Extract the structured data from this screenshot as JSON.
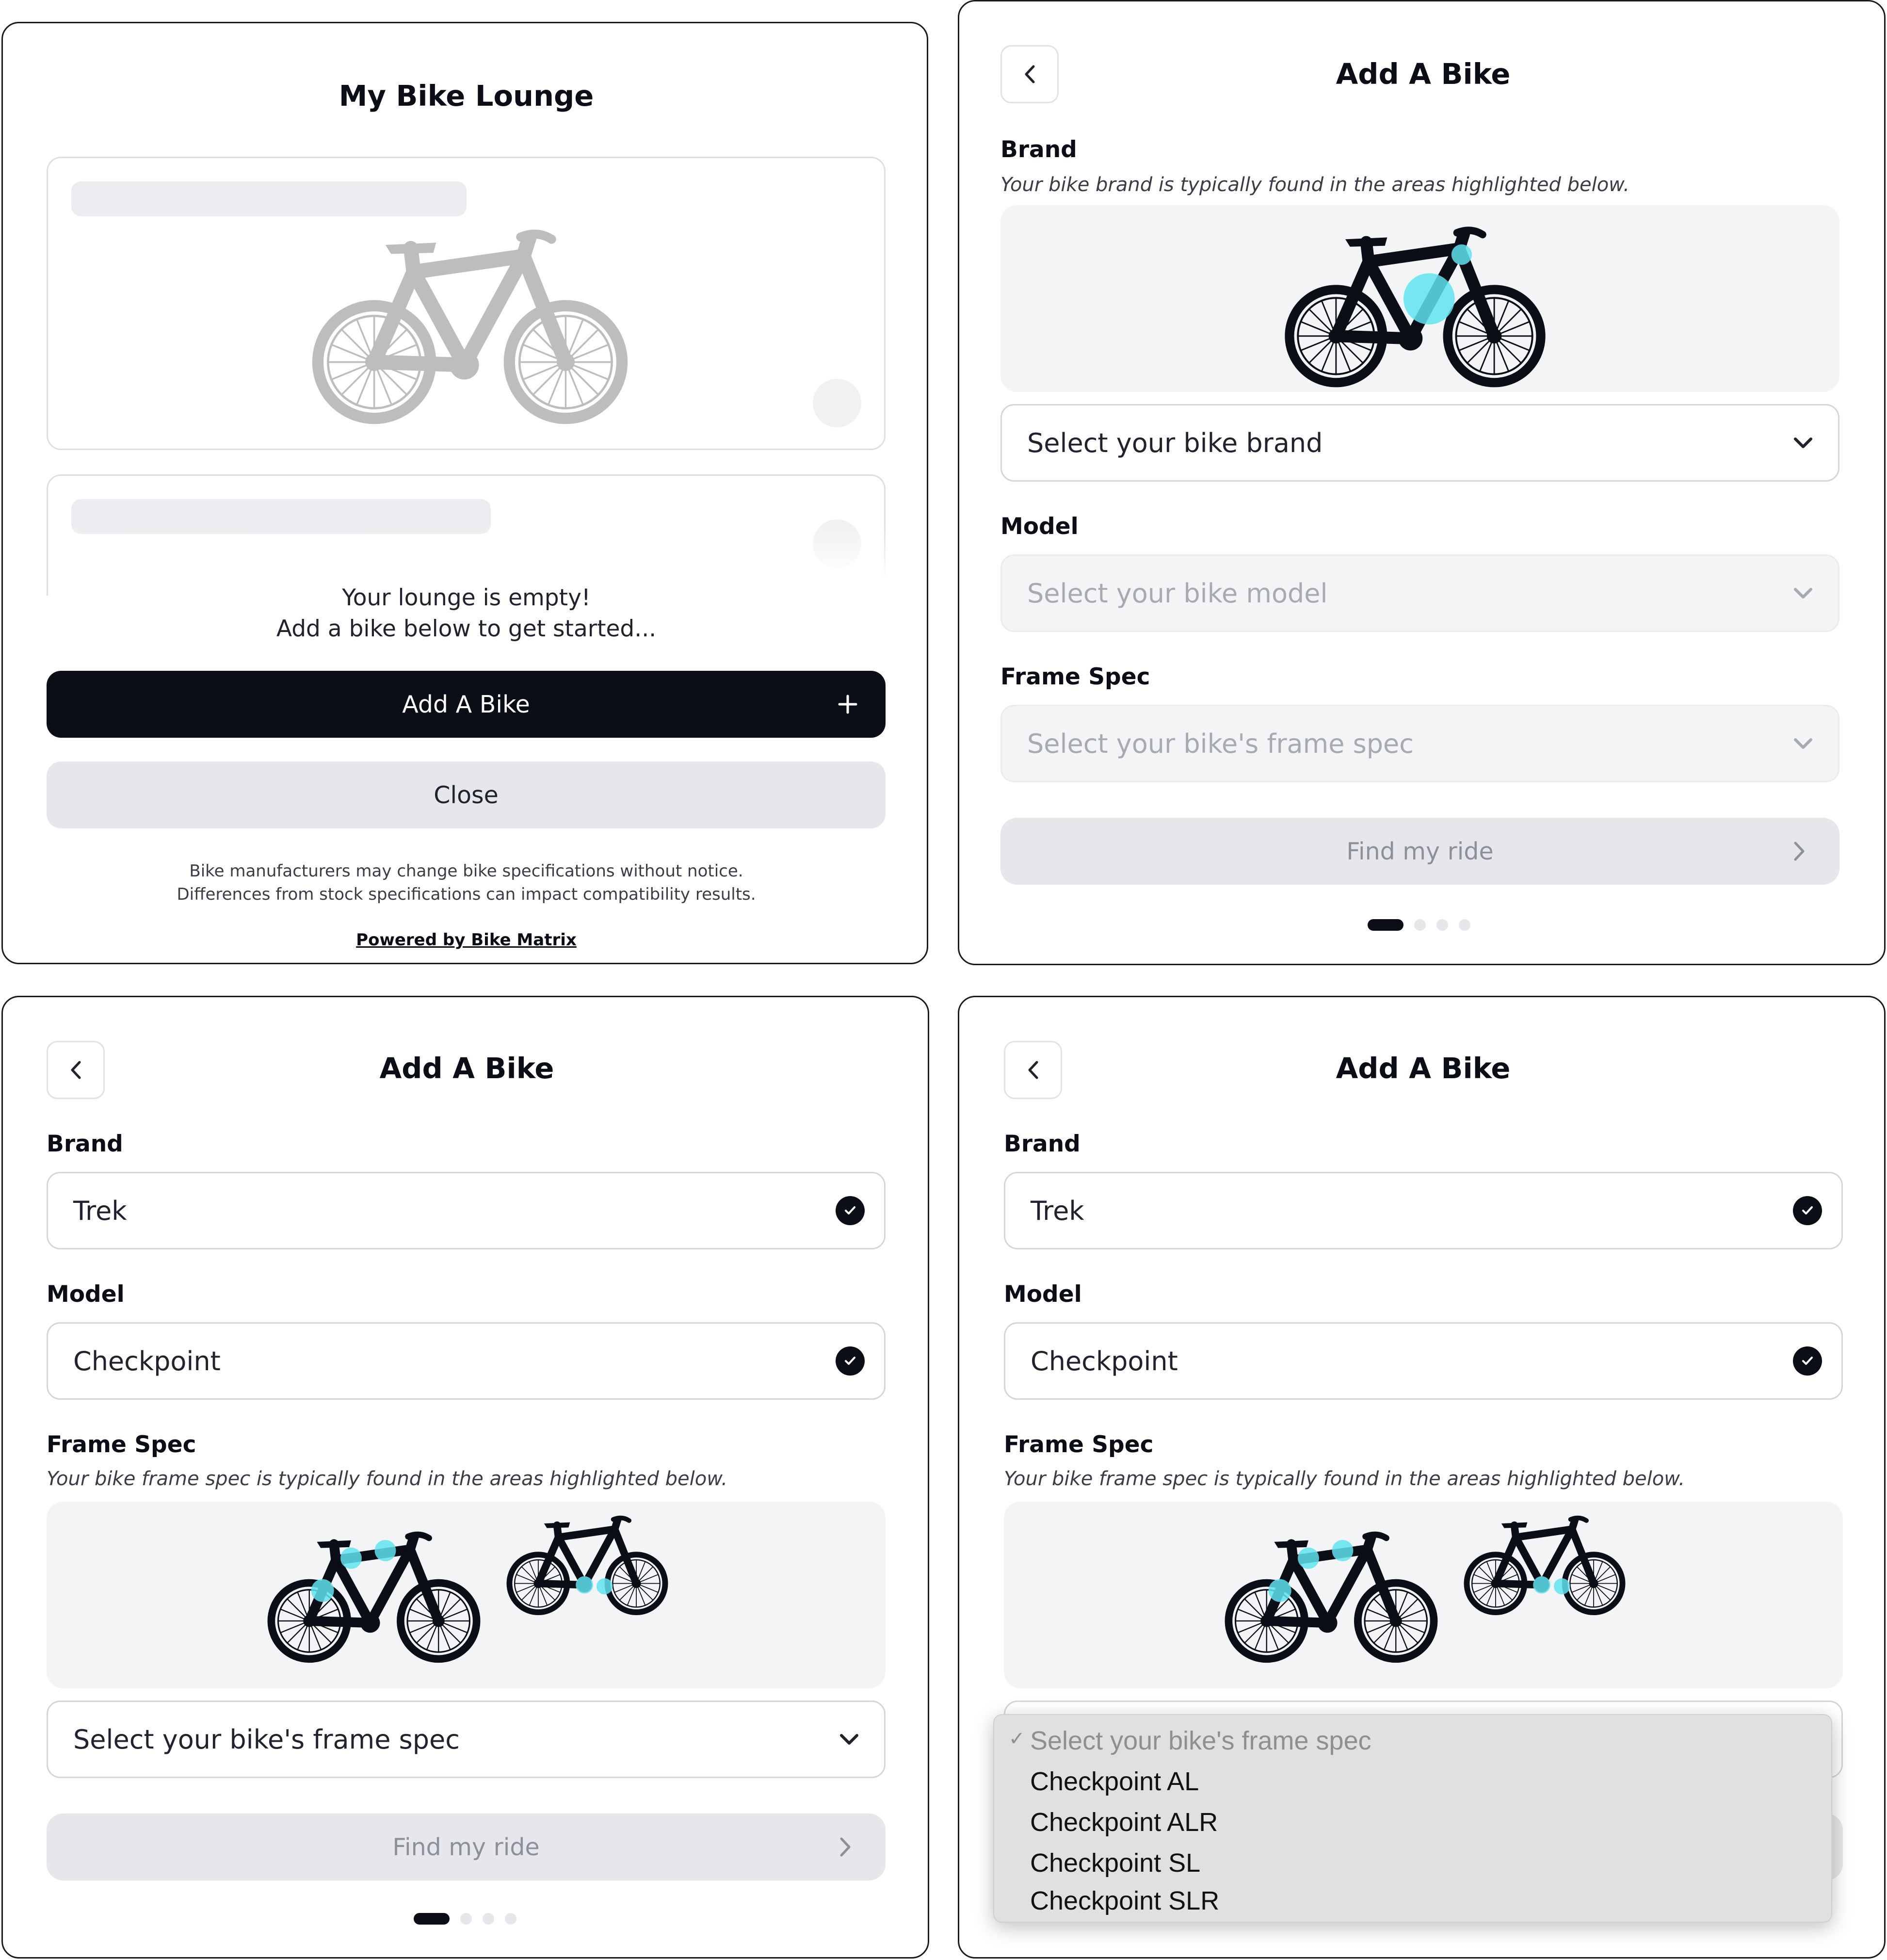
{
  "lounge": {
    "title": "My Bike Lounge",
    "empty_line1": "Your lounge is empty!",
    "empty_line2": "Add a bike below to get started...",
    "add_button": "Add A Bike",
    "add_icon": "plus-icon",
    "close_button": "Close",
    "disclaimer_line1": "Bike manufacturers may change bike specifications without notice.",
    "disclaimer_line2": "Differences from stock specifications can impact compatibility results.",
    "powered_by": "Powered by Bike Matrix"
  },
  "step1": {
    "title": "Add A Bike",
    "back_icon": "chevron-left-icon",
    "brand_label": "Brand",
    "brand_hint": "Your bike brand is typically found in the areas highlighted below.",
    "brand_placeholder": "Select your bike brand",
    "model_label": "Model",
    "model_placeholder": "Select your bike model",
    "frame_label": "Frame Spec",
    "frame_placeholder": "Select your bike's frame spec",
    "find_button": "Find my ride",
    "progress": {
      "total": 4,
      "current": 1
    }
  },
  "step2": {
    "title": "Add A Bike",
    "brand_label": "Brand",
    "brand_value": "Trek",
    "model_label": "Model",
    "model_value": "Checkpoint",
    "frame_label": "Frame Spec",
    "frame_hint": "Your bike frame spec is typically found in the areas highlighted below.",
    "frame_placeholder": "Select your bike's frame spec",
    "find_button": "Find my ride",
    "progress": {
      "total": 4,
      "current": 1
    }
  },
  "step3": {
    "title": "Add A Bike",
    "brand_label": "Brand",
    "brand_value": "Trek",
    "model_label": "Model",
    "model_value": "Checkpoint",
    "frame_label": "Frame Spec",
    "frame_hint": "Your bike frame spec is typically found in the areas highlighted below.",
    "dropdown": {
      "selected_mark": "✓",
      "placeholder": "Select your bike's frame spec",
      "options": [
        "Checkpoint AL",
        "Checkpoint ALR",
        "Checkpoint SL",
        "Checkpoint SLR"
      ]
    }
  },
  "colors": {
    "primary": "#0b0d17",
    "highlight": "#5fe3ef",
    "muted_bg": "#f3f4f6",
    "button_disabled": "#e6e7ea"
  }
}
